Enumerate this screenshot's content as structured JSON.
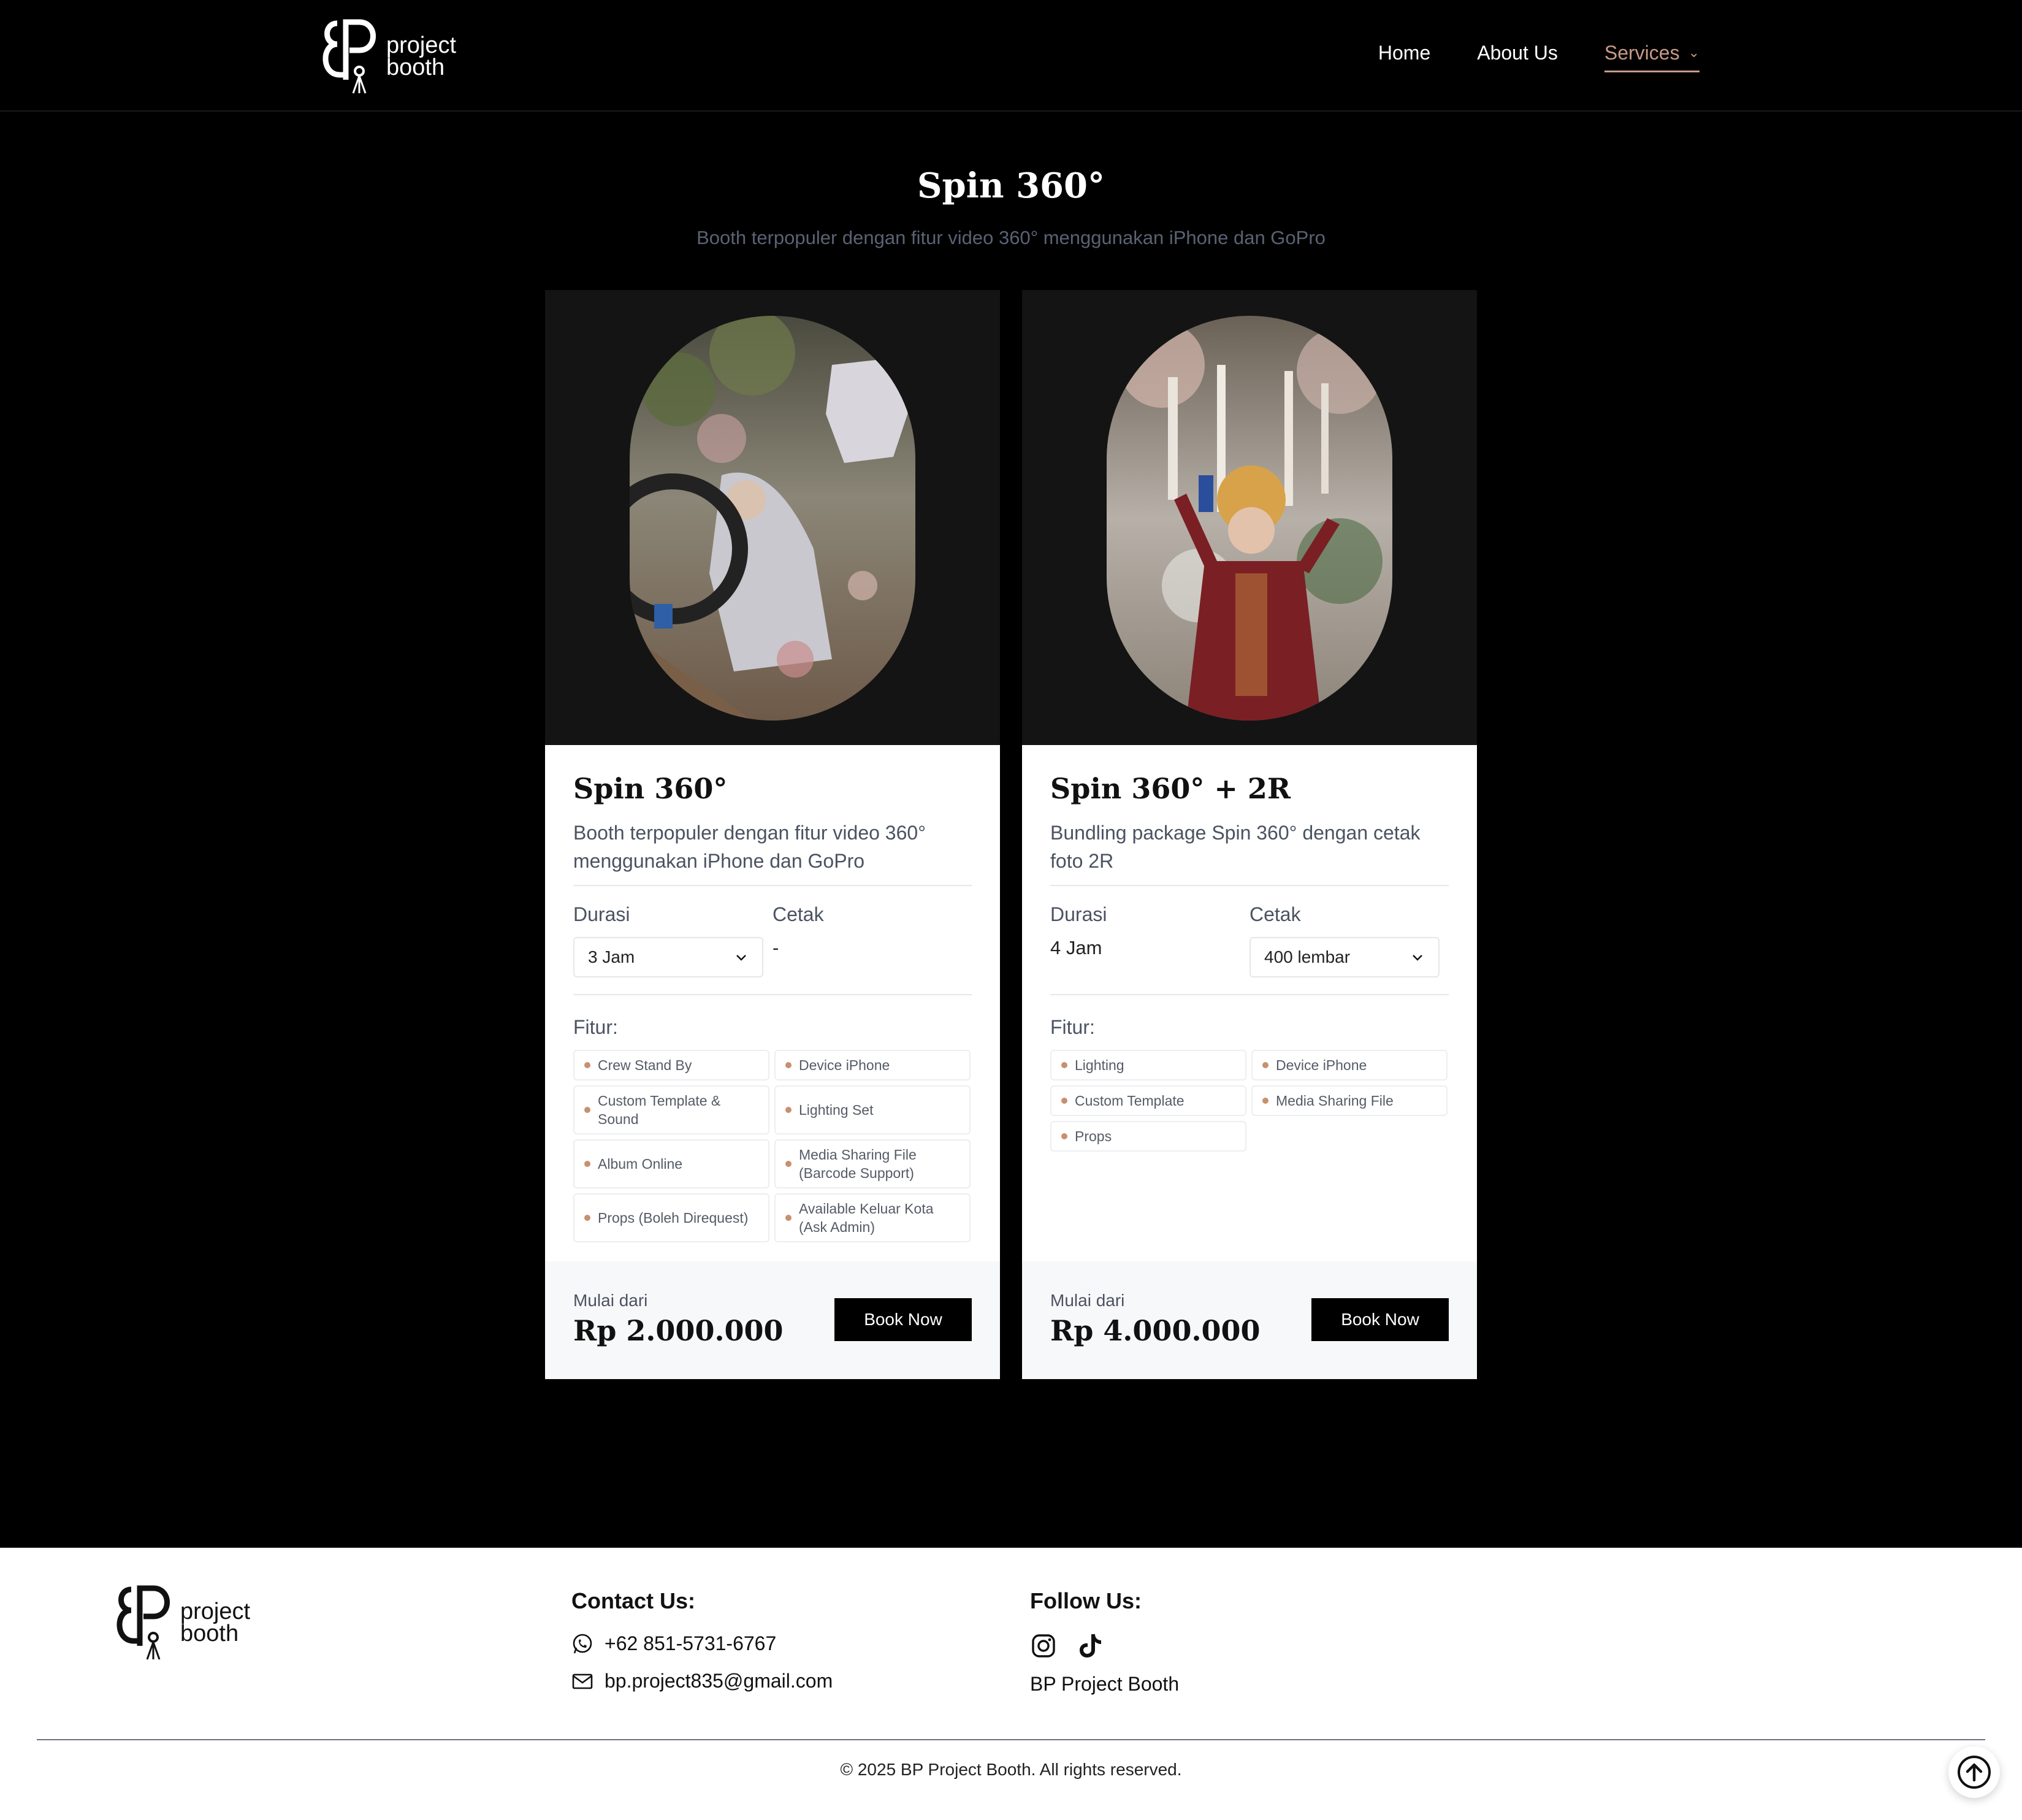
{
  "header": {
    "logo_text_line1": "project",
    "logo_text_line2": "booth",
    "nav": [
      {
        "label": "Home"
      },
      {
        "label": "About Us"
      },
      {
        "label": "Services"
      }
    ]
  },
  "hero": {
    "title": "Spin 360°",
    "subtitle": "Booth terpopuler dengan fitur video 360° menggunakan iPhone dan GoPro"
  },
  "cards": [
    {
      "title": "Spin 360°",
      "description": "Booth terpopuler dengan fitur video 360° menggunakan iPhone dan GoPro",
      "durasi_label": "Durasi",
      "durasi_value": "3 Jam",
      "cetak_label": "Cetak",
      "cetak_value": "-",
      "fitur_label": "Fitur:",
      "features": [
        "Crew Stand By",
        "Device iPhone",
        "Custom Template & Sound",
        "Lighting Set",
        "Album Online",
        "Media Sharing File (Barcode Support)",
        "Props (Boleh Direquest)",
        "Available Keluar Kota (Ask Admin)"
      ],
      "from_label": "Mulai dari",
      "price": "Rp 2.000.000",
      "button": "Book Now"
    },
    {
      "title": "Spin 360° + 2R",
      "description": "Bundling package Spin 360° dengan cetak foto 2R",
      "durasi_label": "Durasi",
      "durasi_value": "4 Jam",
      "cetak_label": "Cetak",
      "cetak_value": "400 lembar",
      "fitur_label": "Fitur:",
      "features": [
        "Lighting",
        "Device iPhone",
        "Custom Template",
        "Media Sharing File",
        "Props"
      ],
      "from_label": "Mulai dari",
      "price": "Rp 4.000.000",
      "button": "Book Now"
    }
  ],
  "footer": {
    "logo_text_line1": "project",
    "logo_text_line2": "booth",
    "contact_heading": "Contact Us:",
    "phone": "+62 851-5731-6767",
    "email": "bp.project835@gmail.com",
    "follow_heading": "Follow Us:",
    "social_name": "BP Project Booth",
    "copyright": "© 2025 BP Project Booth. All rights reserved."
  },
  "colors": {
    "accent": "#c79a86",
    "bullet": "#c7906f",
    "background": "#000000"
  },
  "icons": [
    "chevron-down-icon",
    "whatsapp-icon",
    "mail-icon",
    "instagram-icon",
    "tiktok-icon",
    "arrow-up-icon"
  ]
}
